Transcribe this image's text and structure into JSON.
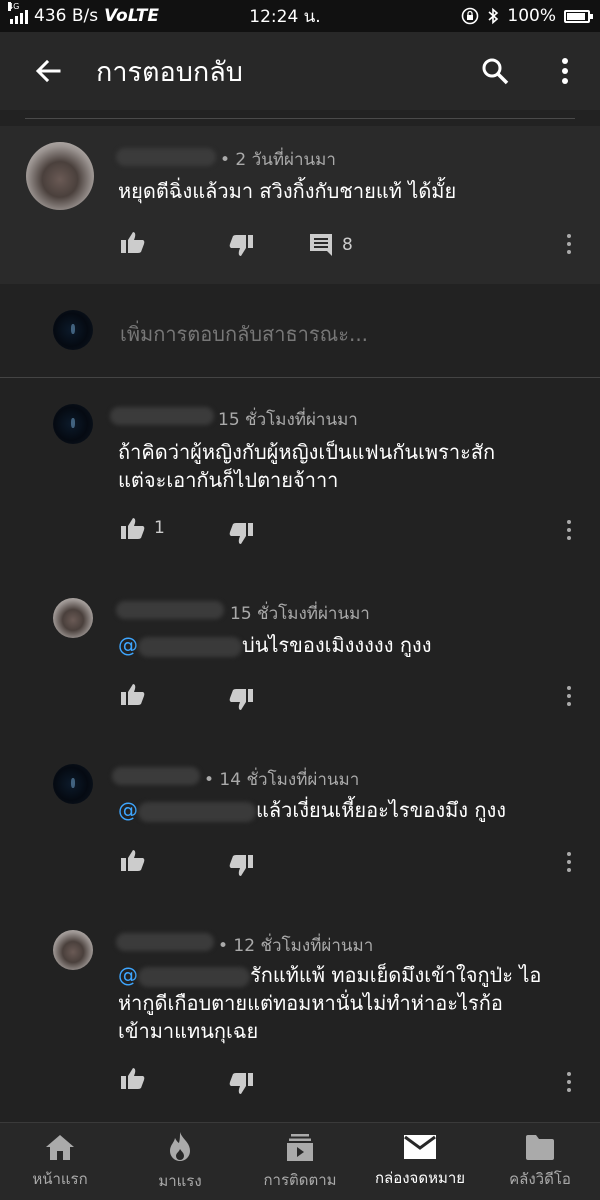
{
  "status_bar": {
    "network_small": "4G",
    "speed": "436 B/s",
    "volte": "VoLTE",
    "time": "12:24 น.",
    "battery": "100%",
    "battery_level": 1.0
  },
  "app_bar": {
    "title": "การตอบกลับ",
    "back_icon": "arrow-back-icon",
    "search_icon": "search-icon",
    "more_icon": "more-vert-icon"
  },
  "parent_comment": {
    "time": "• 2 วันที่ผ่านมา",
    "text": "หยุดตีฉิ่งแล้วมา สวิงกิ้งกับชายแท้ ได้มั้ย",
    "reply_count": "8"
  },
  "add_reply": {
    "placeholder": "เพิ่มการตอบกลับสาธารณะ..."
  },
  "replies": [
    {
      "time": "15 ชั่วโมงที่ผ่านมา",
      "line1": "ถ้าคิดว่าผู้หญิงกับผู้หญิงเป็นแฟนกันเพราะสัก",
      "line2": "แต่จะเอากันก็ไปตายจ้าาา",
      "likes": "1"
    },
    {
      "time": "15 ชั่วโมงที่ผ่านมา",
      "mention": "@",
      "text": "บ่นไรของเมิงงงงง กูงง"
    },
    {
      "time": "• 14 ชั่วโมงที่ผ่านมา",
      "mention": "@",
      "text": "แล้วเงี่ยนเหี้ยอะไรของมึง กูงง"
    },
    {
      "time": "• 12 ชั่วโมงที่ผ่านมา",
      "mention": "@",
      "line1": "รักแท้แพ้ ทอมเย็ดมึงเข้าใจกูป่ะ ไอ",
      "line2": "ห่ากูดีเกือบตายแต่ทอมหานั่นไม่ทำห่าอะไรก้อ",
      "line3": "เข้ามาแทนกุเฉย"
    }
  ],
  "bottom_nav": [
    {
      "label": "หน้าแรก",
      "icon": "home-icon"
    },
    {
      "label": "มาแรง",
      "icon": "trending-flame-icon"
    },
    {
      "label": "การติดตาม",
      "icon": "subscriptions-icon"
    },
    {
      "label": "กล่องจดหมาย",
      "icon": "inbox-mail-icon",
      "active": true
    },
    {
      "label": "คลังวิดีโอ",
      "icon": "library-folder-icon"
    }
  ],
  "colors": {
    "background": "#222222",
    "mention": "#3ea6ff",
    "meta_text": "#aaaaaa"
  }
}
